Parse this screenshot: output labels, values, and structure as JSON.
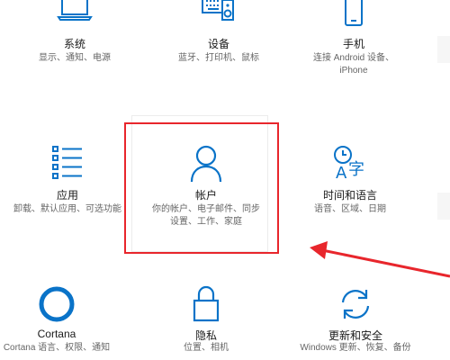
{
  "colors": {
    "icon": "#0a73c8",
    "highlight": "#e8262c",
    "title": "#1a1a1a",
    "desc": "#666666"
  },
  "tiles": {
    "system": {
      "icon": "laptop-icon",
      "title": "系统",
      "desc": "显示、通知、电源"
    },
    "devices": {
      "icon": "keyboard-speaker-icon",
      "title": "设备",
      "desc": "蓝牙、打印机、鼠标"
    },
    "phone": {
      "icon": "phone-icon",
      "title": "手机",
      "desc": "连接 Android 设备、",
      "desc2": "iPhone"
    },
    "apps": {
      "icon": "apps-list-icon",
      "title": "应用",
      "desc": "卸载、默认应用、可选功能"
    },
    "account": {
      "icon": "person-icon",
      "title": "帐户",
      "desc": "你的帐户、电子邮件、同步",
      "desc2": "设置、工作、家庭"
    },
    "time": {
      "icon": "time-language-icon",
      "title": "时间和语言",
      "desc": "语音、区域、日期"
    },
    "cortana": {
      "icon": "cortana-icon",
      "title": "Cortana",
      "desc": "Cortana 语言、权限、通知"
    },
    "privacy": {
      "icon": "lock-icon",
      "title": "隐私",
      "desc": "位置、相机"
    },
    "update": {
      "icon": "refresh-icon",
      "title": "更新和安全",
      "desc": "Windows 更新、恢复、备份"
    }
  }
}
